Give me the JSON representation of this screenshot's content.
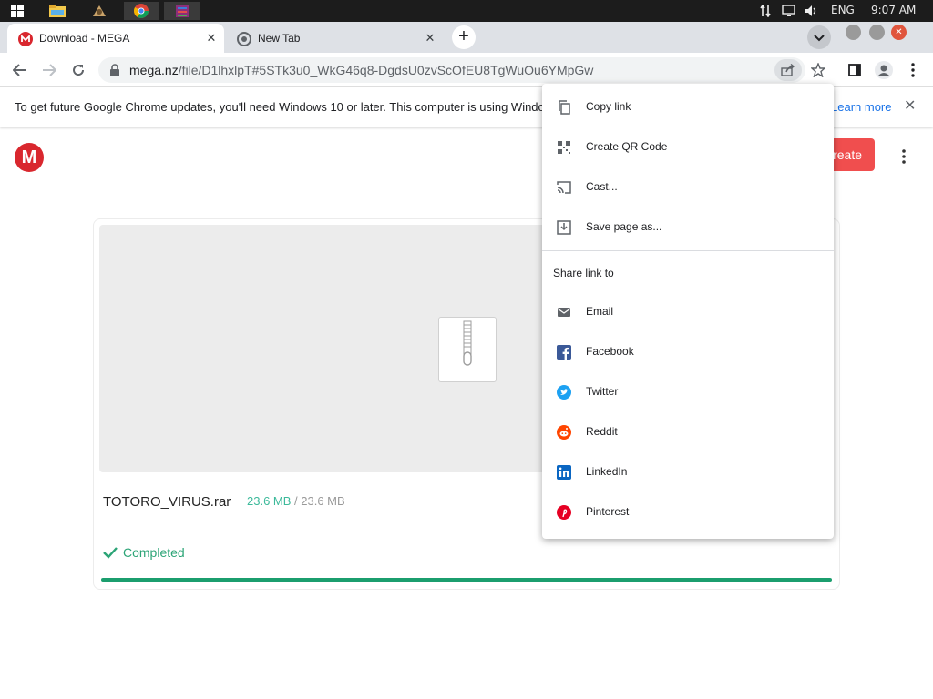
{
  "taskbar": {
    "input_language": "ENG",
    "clock": "9:07 AM"
  },
  "tabs": [
    {
      "title": "Download - MEGA",
      "active": true
    },
    {
      "title": "New Tab",
      "active": false
    }
  ],
  "toolbar": {
    "url_host": "mega.nz",
    "url_path": "/file/D1lhxlpT#5STk3u0_WkG46q8-DgdsU0zvScOfEU8TgWuOu6YMpGw"
  },
  "infobar": {
    "message": "To get future Google Chrome updates, you'll need Windows 10 or later. This computer is using Windo",
    "link": "Learn more"
  },
  "page": {
    "logo_letter": "M",
    "create_account_label": "Create Account",
    "file_name": "TOTORO_VIRUS.rar",
    "downloaded": "23.6 MB",
    "size_separator": " / ",
    "total": "23.6 MB",
    "status": "Completed",
    "progress_percent": 100
  },
  "share_menu": {
    "items": [
      "Copy link",
      "Create QR Code",
      "Cast...",
      "Save page as..."
    ],
    "share_header": "Share link to",
    "share_targets": [
      "Email",
      "Facebook",
      "Twitter",
      "Reddit",
      "LinkedIn",
      "Pinterest"
    ]
  },
  "colors": {
    "mega_red": "#d9272e",
    "accent_green": "#1b9e6e",
    "link_blue": "#1a73e8",
    "facebook": "#3b5998",
    "twitter": "#1da1f2",
    "reddit": "#ff4500",
    "linkedin": "#0a66c2",
    "pinterest": "#e60023"
  },
  "icons": [
    "windows-start-icon",
    "file-explorer-icon",
    "app-icon",
    "chrome-icon",
    "winrar-icon",
    "network-icon",
    "volume-icon",
    "lock-icon",
    "share-icon",
    "star-icon",
    "side-panel-icon",
    "profile-icon",
    "copy-icon",
    "qr-code-icon",
    "cast-icon",
    "save-icon",
    "email-icon",
    "facebook-icon",
    "twitter-icon",
    "reddit-icon",
    "linkedin-icon",
    "pinterest-icon",
    "zip-file-icon",
    "check-icon"
  ]
}
